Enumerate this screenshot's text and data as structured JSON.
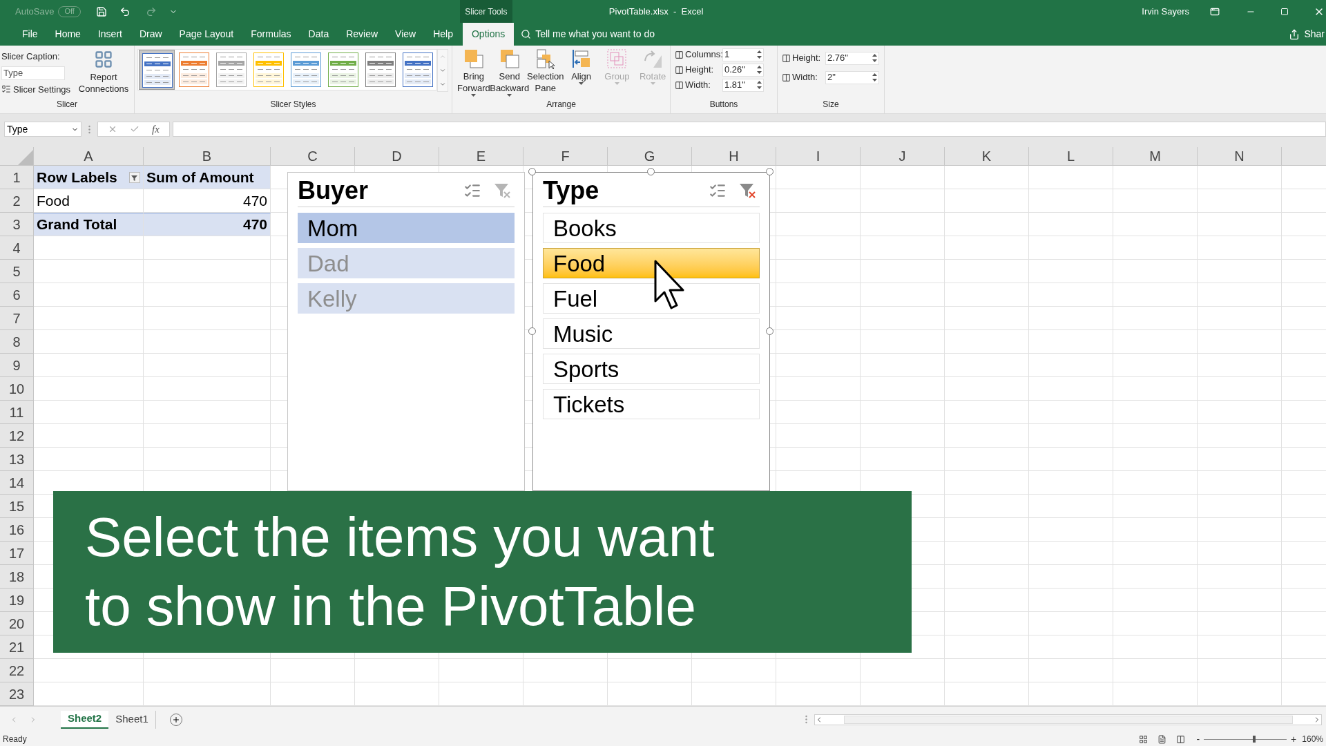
{
  "title_bar": {
    "autosave_label": "AutoSave",
    "autosave_state": "Off",
    "context_tab": "Slicer Tools",
    "title": "PivotTable.xlsx  -  Excel",
    "user": "Irvin Sayers"
  },
  "ribbon_tabs": [
    {
      "label": "File",
      "selected": false
    },
    {
      "label": "Home",
      "selected": false
    },
    {
      "label": "Insert",
      "selected": false
    },
    {
      "label": "Draw",
      "selected": false
    },
    {
      "label": "Page Layout",
      "selected": false
    },
    {
      "label": "Formulas",
      "selected": false
    },
    {
      "label": "Data",
      "selected": false
    },
    {
      "label": "Review",
      "selected": false
    },
    {
      "label": "View",
      "selected": false
    },
    {
      "label": "Help",
      "selected": false
    },
    {
      "label": "Options",
      "selected": true
    }
  ],
  "tell_me": "Tell me what you want to do",
  "share": "Shar",
  "slicer_group": {
    "caption_label": "Slicer Caption:",
    "caption_value": "Type",
    "settings": "Slicer Settings",
    "report_connections": "Report Connections",
    "label": "Slicer"
  },
  "slicer_styles": {
    "label": "Slicer Styles",
    "styles": [
      {
        "color": "#4472c4",
        "selected": true
      },
      {
        "color": "#ed7d31",
        "selected": false
      },
      {
        "color": "#a5a5a5",
        "selected": false
      },
      {
        "color": "#ffc000",
        "selected": false
      },
      {
        "color": "#5b9bd5",
        "selected": false
      },
      {
        "color": "#70ad47",
        "selected": false
      },
      {
        "color": "#7f7f7f",
        "selected": false
      },
      {
        "color": "#4472c4",
        "selected": false
      }
    ]
  },
  "arrange": {
    "label": "Arrange",
    "buttons": [
      {
        "kind": "bring",
        "label": "Bring Forward",
        "dropdown": true,
        "disabled": false
      },
      {
        "kind": "send",
        "label": "Send Backward",
        "dropdown": true,
        "disabled": false
      },
      {
        "kind": "pane",
        "label": "Selection Pane",
        "dropdown": false,
        "disabled": false
      },
      {
        "kind": "align",
        "label": "Align",
        "dropdown": true,
        "disabled": false
      },
      {
        "kind": "group",
        "label": "Group",
        "dropdown": true,
        "disabled": true
      },
      {
        "kind": "rotate",
        "label": "Rotate",
        "dropdown": true,
        "disabled": true
      }
    ]
  },
  "buttons_group": {
    "label": "Buttons",
    "fields": [
      {
        "label": "Columns:",
        "value": "1"
      },
      {
        "label": "Height:",
        "value": "0.26\""
      },
      {
        "label": "Width:",
        "value": "1.81\""
      }
    ]
  },
  "size_group": {
    "label": "Size",
    "fields": [
      {
        "label": "Height:",
        "value": "2.76\""
      },
      {
        "label": "Width:",
        "value": "2\""
      }
    ]
  },
  "name_box": "Type",
  "fx": "fx",
  "columns": [
    "A",
    "B",
    "C",
    "D",
    "E",
    "F",
    "G",
    "H",
    "I",
    "J",
    "K",
    "L",
    "M",
    "N"
  ],
  "rows": [
    "1",
    "2",
    "3",
    "4",
    "5",
    "6",
    "7",
    "8",
    "9",
    "10",
    "11",
    "12",
    "13",
    "14",
    "15",
    "16",
    "17",
    "18",
    "19",
    "20",
    "21",
    "22",
    "23"
  ],
  "pivot": {
    "header": [
      "Row Labels",
      "Sum of Amount"
    ],
    "rows": [
      {
        "kind": "item",
        "label": "Food",
        "value": "470"
      },
      {
        "kind": "total",
        "label": "Grand Total",
        "value": "470"
      }
    ]
  },
  "slicers": [
    {
      "title": "Buyer",
      "active": false,
      "filtered": false,
      "items": [
        {
          "label": "Mom",
          "selected": true,
          "has_data": true
        },
        {
          "label": "Dad",
          "selected": false,
          "has_data": false
        },
        {
          "label": "Kelly",
          "selected": false,
          "has_data": false
        }
      ]
    },
    {
      "title": "Type",
      "active": true,
      "filtered": true,
      "items": [
        {
          "label": "Books",
          "selected": false,
          "has_data": true
        },
        {
          "label": "Food",
          "selected": true,
          "has_data": true
        },
        {
          "label": "Fuel",
          "selected": false,
          "has_data": true
        },
        {
          "label": "Music",
          "selected": false,
          "has_data": true
        },
        {
          "label": "Sports",
          "selected": false,
          "has_data": true
        },
        {
          "label": "Tickets",
          "selected": false,
          "has_data": true
        }
      ]
    }
  ],
  "banner": {
    "lines": [
      "Select the items you want",
      "to show in the PivotTable"
    ]
  },
  "sheet_tabs": [
    {
      "label": "Sheet2",
      "selected": true
    },
    {
      "label": "Sheet1",
      "selected": false
    }
  ],
  "status": "Ready",
  "zoom": {
    "minus": "-",
    "plus": "+",
    "level": 0.59,
    "reading": "160%"
  }
}
